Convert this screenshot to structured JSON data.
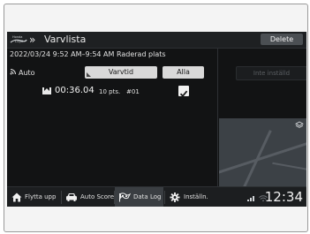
{
  "header": {
    "title": "Varvlista",
    "delete_label": "Delete"
  },
  "subheader": {
    "date_range": "2022/03/24 9:52 AM–9:54 AM Raderad plats",
    "auto_label": "Auto"
  },
  "tabs": [
    {
      "label": "Varvtid"
    },
    {
      "label": "Alla"
    }
  ],
  "laps": [
    {
      "time": "00:36.04",
      "points": "10 pts.",
      "number": "#01",
      "checked": true
    }
  ],
  "right_panel": {
    "inst_button": "Inte inställd"
  },
  "bottom_nav": [
    {
      "label": "Flytta upp",
      "icon": "home-icon"
    },
    {
      "label": "Auto Score",
      "icon": "car-icon"
    },
    {
      "label": "Data Log",
      "icon": "data-log-flag-icon",
      "active": true
    },
    {
      "label": "Inställn.",
      "icon": "gear-icon"
    }
  ],
  "status": {
    "time": "12:34"
  },
  "colors": {
    "screen_bg": "#121314",
    "tab_bg": "#d9d9d9",
    "active_nav_bg": "#3a3e42"
  }
}
